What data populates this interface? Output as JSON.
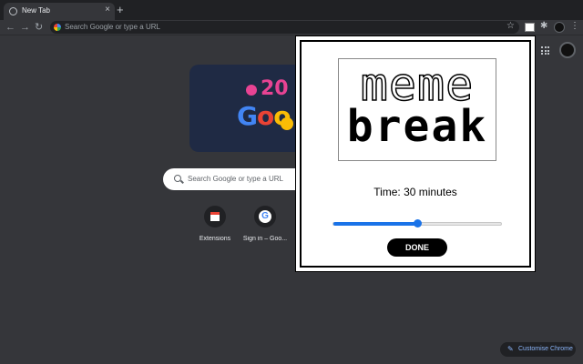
{
  "browser": {
    "tab": {
      "title": "New Tab",
      "close": "×"
    },
    "new_tab_symbol": "+",
    "omnibox_placeholder": "Search Google or type a URL",
    "nav": {
      "back": "←",
      "forward": "→",
      "reload": "↻"
    },
    "star": "☆",
    "puzzle": "✱",
    "menu": "⋮"
  },
  "ntp": {
    "doodle": {
      "year_fragment": "20",
      "word_b": "G",
      "word_r": "o",
      "word_y": "o"
    },
    "search_placeholder": "Search Google or type a URL",
    "shortcuts": [
      {
        "label": "Extensions",
        "icon": "extensions-icon"
      },
      {
        "label": "Sign in – Goo...",
        "icon": "google-icon",
        "glyph": "G"
      }
    ],
    "customise_label": "Customise Chrome",
    "customise_icon": "✎"
  },
  "popup": {
    "meme_word": "meme",
    "break_word": "break",
    "time_text": "Time: 30 minutes",
    "slider_fraction": 0.5,
    "done_label": "DONE"
  },
  "colors": {
    "accent": "#1a73e8",
    "background": "#35363a",
    "tabstrip": "#202124"
  }
}
